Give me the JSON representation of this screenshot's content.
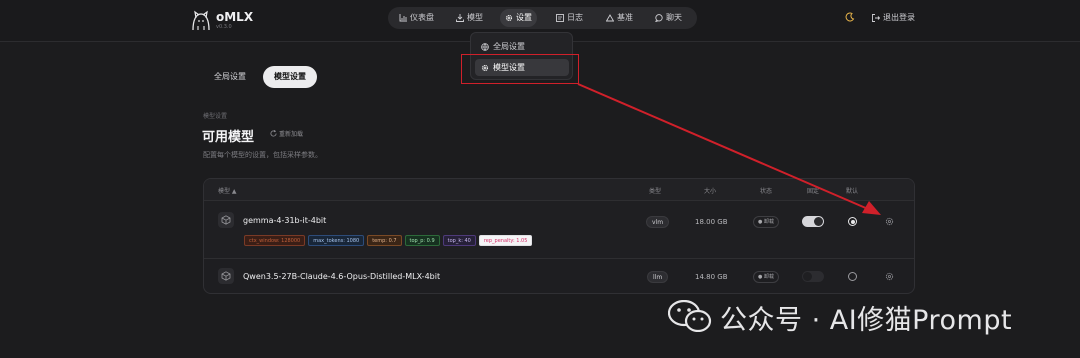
{
  "app": {
    "name": "oMLX",
    "version": "v0.3.0"
  },
  "nav": {
    "items": [
      {
        "label": "仪表盘",
        "icon": "chart-icon"
      },
      {
        "label": "模型",
        "icon": "download-icon"
      },
      {
        "label": "设置",
        "icon": "gear-icon"
      },
      {
        "label": "日志",
        "icon": "log-icon"
      },
      {
        "label": "基准",
        "icon": "benchmark-icon"
      },
      {
        "label": "聊天",
        "icon": "chat-icon"
      }
    ],
    "active": "设置"
  },
  "header_right": {
    "theme_icon": "moon-icon",
    "logout_label": "退出登录"
  },
  "settings_dropdown": {
    "items": [
      {
        "label": "全局设置",
        "icon": "globe-icon"
      },
      {
        "label": "模型设置",
        "icon": "gear-icon"
      }
    ],
    "selected": "模型设置"
  },
  "tabs": [
    {
      "label": "全局设置"
    },
    {
      "label": "模型设置"
    }
  ],
  "section": {
    "breadcrumb": "模型设置",
    "title": "可用模型",
    "reload_label": "重新加载",
    "description": "配置每个模型的设置，包括采样参数。"
  },
  "table": {
    "headers": {
      "model": "模型 ▲",
      "type": "类型",
      "size": "大小",
      "status": "状态",
      "pin": "固定",
      "default": "默认"
    },
    "rows": [
      {
        "name": "gemma-4-31b-it-4bit",
        "type": "vlm",
        "size": "18.00 GB",
        "status": "● 卸载",
        "pinned": true,
        "default": true,
        "params": [
          {
            "label": "ctx_window: 128000",
            "kind": "ctx"
          },
          {
            "label": "max_tokens: 1080",
            "kind": "max"
          },
          {
            "label": "temp: 0.7",
            "kind": "temp"
          },
          {
            "label": "top_p: 0.9",
            "kind": "topp"
          },
          {
            "label": "top_k: 40",
            "kind": "topk"
          },
          {
            "label": "rep_penalty: 1.05",
            "kind": "rep"
          }
        ]
      },
      {
        "name": "Qwen3.5-27B-Claude-4.6-Opus-Distilled-MLX-4bit",
        "type": "llm",
        "size": "14.80 GB",
        "status": "● 卸载",
        "pinned": false,
        "default": false,
        "params": []
      }
    ]
  },
  "watermark": {
    "text": "公众号 · AI修猫Prompt"
  },
  "colors": {
    "background": "#1c1c1e",
    "annotation_red": "#d0202a"
  }
}
